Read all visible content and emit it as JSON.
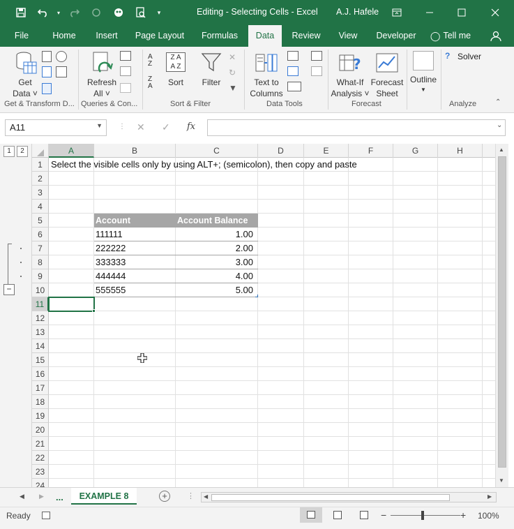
{
  "window": {
    "title": "Editing - Selecting Cells  -  Excel",
    "user": "A.J. Hafele"
  },
  "tabs": [
    {
      "label": "File"
    },
    {
      "label": "Home"
    },
    {
      "label": "Insert"
    },
    {
      "label": "Page Layout"
    },
    {
      "label": "Formulas"
    },
    {
      "label": "Data"
    },
    {
      "label": "Review"
    },
    {
      "label": "View"
    },
    {
      "label": "Developer"
    },
    {
      "label": "Tell me"
    }
  ],
  "ribbon": {
    "get_data": "Get",
    "get_data_2": "Data ˅",
    "refresh": "Refresh",
    "refresh_2": "All ˅",
    "sort": "Sort",
    "filter": "Filter",
    "text_to_columns": "Text to",
    "text_to_columns_2": "Columns",
    "whatif": "What-If",
    "whatif_2": "Analysis ˅",
    "forecast": "Forecast",
    "forecast_2": "Sheet",
    "outline": "Outline",
    "solver": "Solver",
    "groups": {
      "get_transform": "Get & Transform D...",
      "queries": "Queries & Con...",
      "sort_filter": "Sort & Filter",
      "data_tools": "Data Tools",
      "forecast": "Forecast",
      "analyze": "Analyze"
    }
  },
  "formula_bar": {
    "name_box": "A11",
    "fx": "fx",
    "content": ""
  },
  "outline_levels": [
    "1",
    "2"
  ],
  "columns": [
    "A",
    "B",
    "C",
    "D",
    "E",
    "F",
    "G",
    "H"
  ],
  "rows": [
    "1",
    "2",
    "3",
    "4",
    "5",
    "6",
    "7",
    "8",
    "9",
    "10",
    "11",
    "12",
    "13",
    "14",
    "15",
    "16",
    "17",
    "18",
    "19",
    "20",
    "21",
    "22",
    "23",
    "24"
  ],
  "sheet": {
    "a1": "Select the visible cells only by using ALT+; (semicolon), then copy and paste",
    "table_header": {
      "account": "Account",
      "balance": "Account Balance"
    },
    "table_rows": [
      {
        "account": "111111",
        "balance": "1.00"
      },
      {
        "account": "222222",
        "balance": "2.00"
      },
      {
        "account": "333333",
        "balance": "3.00"
      },
      {
        "account": "444444",
        "balance": "4.00"
      },
      {
        "account": "555555",
        "balance": "5.00"
      }
    ]
  },
  "sheet_tabs": {
    "more": "...",
    "active": "EXAMPLE 8"
  },
  "status": {
    "ready": "Ready",
    "zoom": "100%"
  },
  "colors": {
    "excel_green": "#217346",
    "table_header_bg": "#a6a6a6"
  }
}
